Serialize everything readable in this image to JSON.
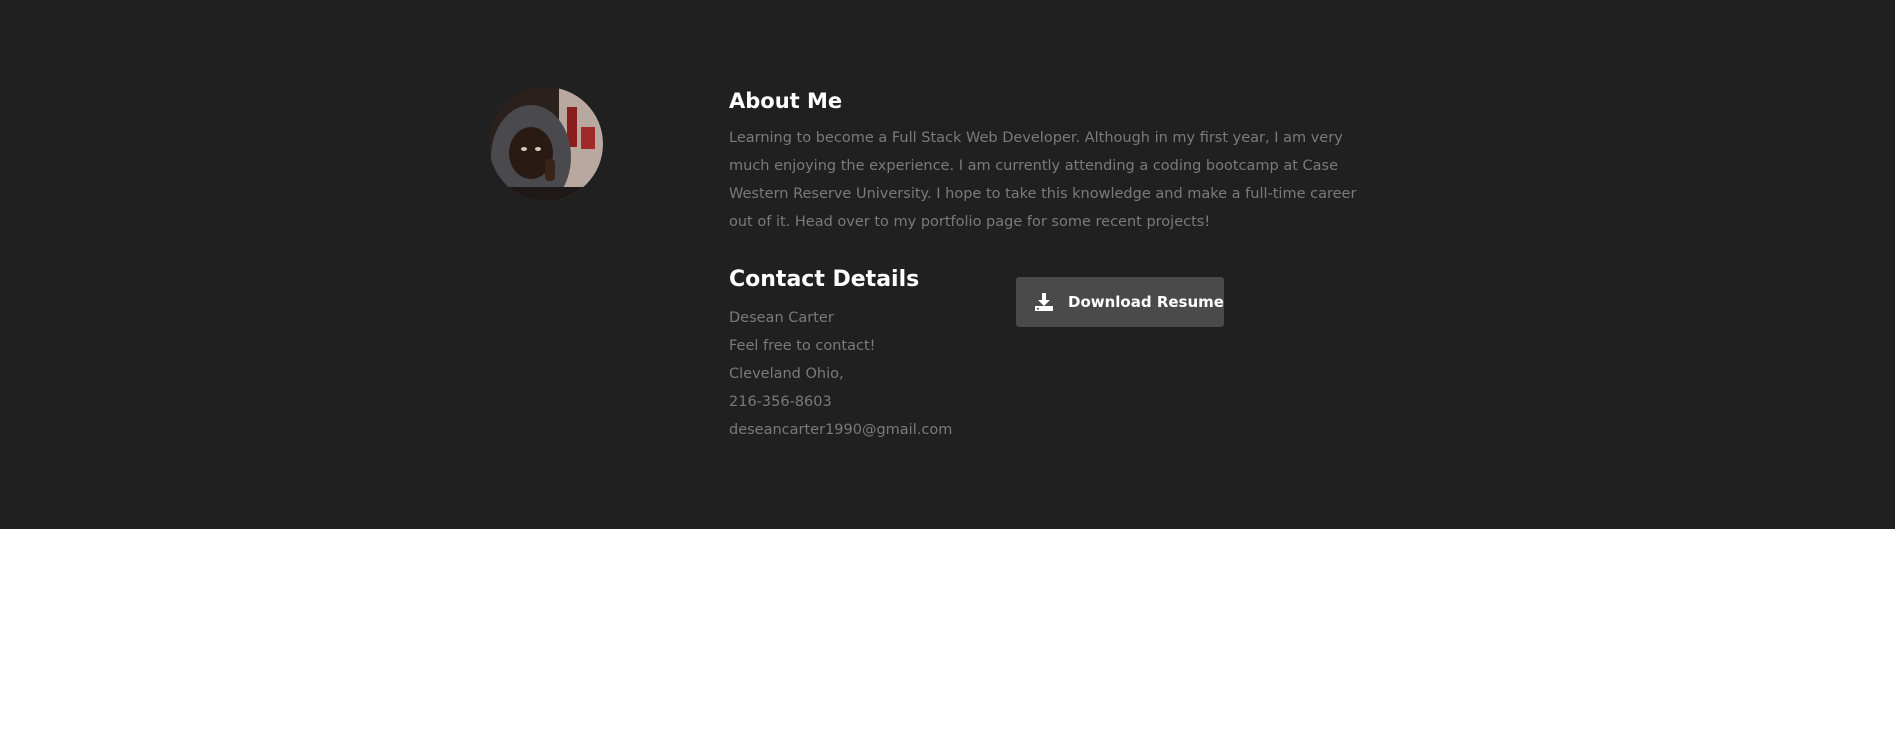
{
  "about": {
    "title": "About Me",
    "text": "Learning to become a Full Stack Web Developer. Although in my first year, I am very much enjoying the experience. I am currently attending a coding bootcamp at Case Western Reserve University. I hope to take this knowledge and make a full-time career out of it. Head over to my portfolio page for some recent projects!"
  },
  "contact": {
    "title": "Contact Details",
    "name": "Desean Carter",
    "tagline": "Feel free to contact!",
    "location": "Cleveland Ohio,",
    "phone": "216-356-8603",
    "email": "deseancarter1990@gmail.com"
  },
  "resume_button": {
    "label": "Download Resume",
    "icon": "download-icon"
  },
  "colors": {
    "section_background": "#202020",
    "heading": "#ffffff",
    "body_text": "#7a7a7a",
    "button_background": "#4a4a4a",
    "page_background": "#ffffff"
  }
}
